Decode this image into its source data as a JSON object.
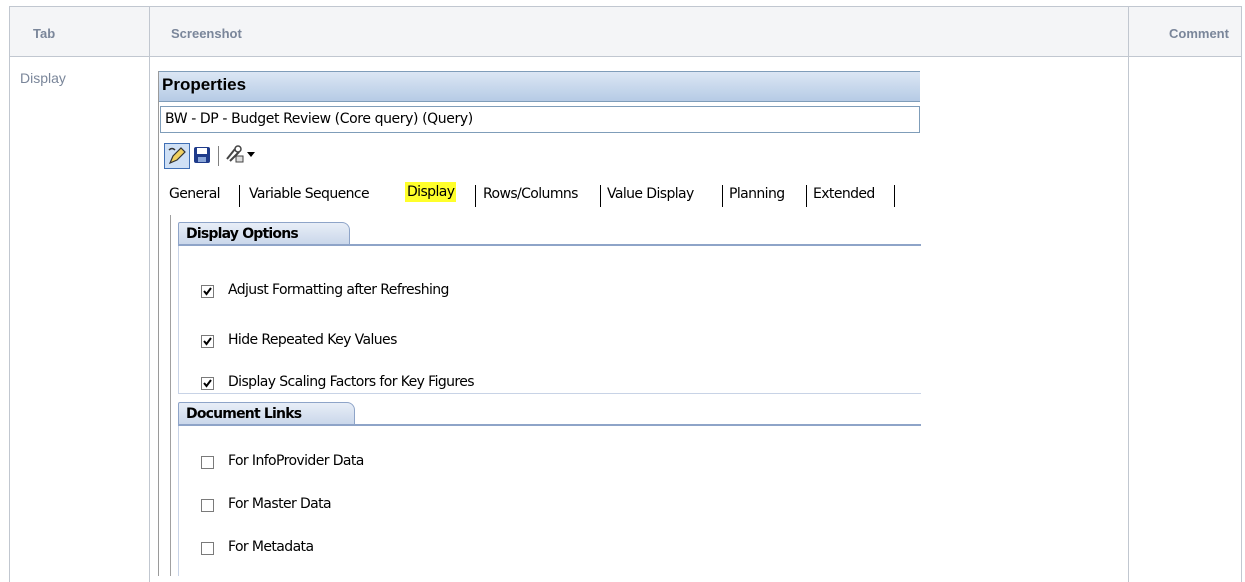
{
  "table": {
    "headers": {
      "tab": "Tab",
      "screenshot": "Screenshot",
      "comment": "Comment"
    },
    "row": {
      "tab": "Display"
    }
  },
  "properties": {
    "title": "Properties",
    "query_name": "BW - DP - Budget Review (Core query) (Query)",
    "toolbar": [
      "edit-icon",
      "save-icon",
      "tools-icon",
      "dropdown-arrow-icon"
    ],
    "tabs": [
      "General",
      "Variable Sequence",
      "Display",
      "Rows/Columns",
      "Value Display",
      "Planning",
      "Extended"
    ],
    "selected_tab": "Display",
    "display_options": {
      "title": "Display Options",
      "items": [
        {
          "label": "Adjust Formatting after Refreshing",
          "checked": true
        },
        {
          "label": "Hide Repeated Key Values",
          "checked": true
        },
        {
          "label": "Display Scaling Factors for Key Figures",
          "checked": true
        }
      ]
    },
    "document_links": {
      "title": "Document Links",
      "items": [
        {
          "label": "For InfoProvider Data",
          "checked": false
        },
        {
          "label": "For Master Data",
          "checked": false
        },
        {
          "label": "For Metadata",
          "checked": false
        }
      ]
    }
  },
  "colors": {
    "highlight": "#ffff2a",
    "title_bar": "#b6cbe5",
    "header_bg": "#f4f5f7"
  }
}
